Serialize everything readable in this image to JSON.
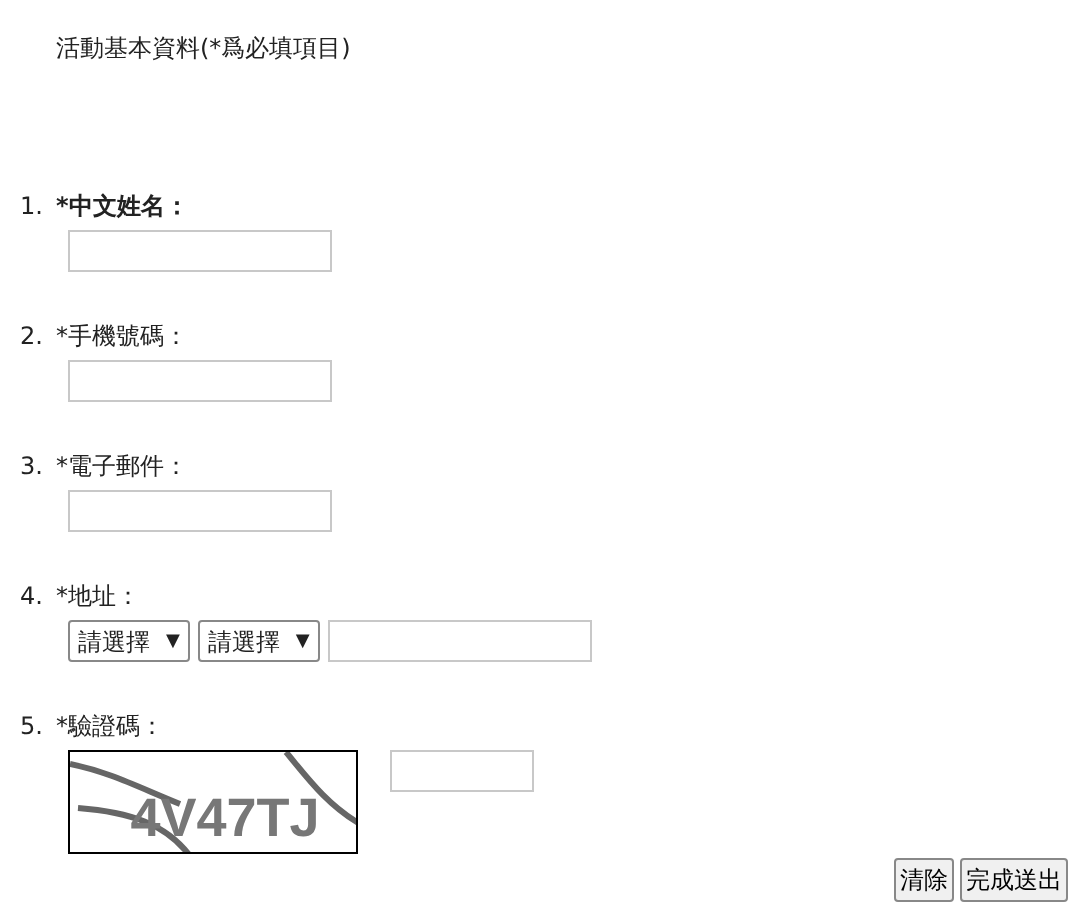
{
  "title": "活動基本資料(*爲必填項目)",
  "fields": [
    {
      "number": "1.",
      "label": "*中文姓名：",
      "bold": true,
      "kind": "text"
    },
    {
      "number": "2.",
      "label": "*手機號碼：",
      "bold": false,
      "kind": "text"
    },
    {
      "number": "3.",
      "label": "*電子郵件：",
      "bold": false,
      "kind": "text"
    },
    {
      "number": "4.",
      "label": "*地址：",
      "bold": false,
      "kind": "address",
      "selects": [
        {
          "value": "請選擇",
          "arrow": "▼"
        },
        {
          "value": "請選擇",
          "arrow": "▼"
        }
      ]
    },
    {
      "number": "5.",
      "label": "*驗證碼：",
      "bold": false,
      "kind": "captcha",
      "captcha_text": "4V47TJ"
    }
  ],
  "buttons": [
    "清除",
    "完成送出"
  ]
}
